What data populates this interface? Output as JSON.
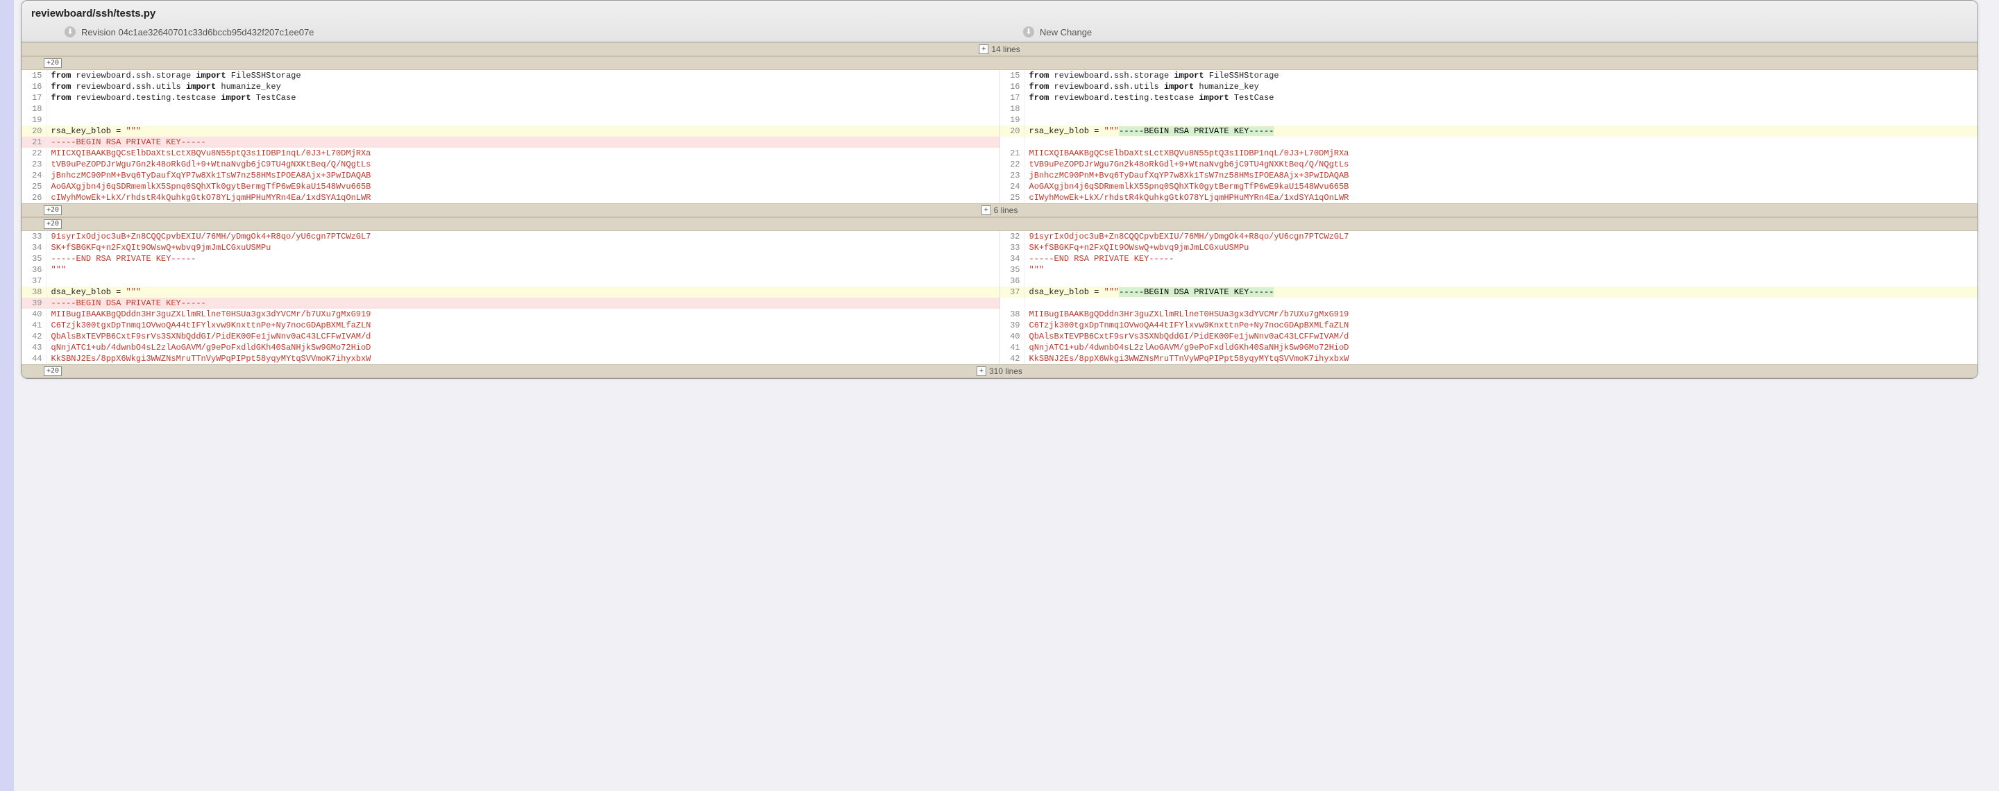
{
  "file": {
    "title": "reviewboard/ssh/tests.py",
    "left_revision_label": "Revision 04c1ae32640701c33d6bccb95d432f207c1ee07e",
    "right_revision_label": "New Change"
  },
  "expands": {
    "top_count": "14 lines",
    "mid_count": "6 lines",
    "bottom_count": "310 lines",
    "chunk_label": "20"
  },
  "blocks": [
    {
      "expand_above": {
        "ln": "20"
      },
      "rows": [
        {
          "type": "normal",
          "lng": "15",
          "rng": "15",
          "ltokens": [
            [
              "kw",
              "from"
            ],
            [
              "plain",
              " reviewboard.ssh.storage "
            ],
            [
              "kw",
              "import"
            ],
            [
              "plain",
              " FileSSHStorage"
            ]
          ],
          "rtokens": [
            [
              "kw",
              "from"
            ],
            [
              "plain",
              " reviewboard.ssh.storage "
            ],
            [
              "kw",
              "import"
            ],
            [
              "plain",
              " FileSSHStorage"
            ]
          ]
        },
        {
          "type": "normal",
          "lng": "16",
          "rng": "16",
          "ltokens": [
            [
              "kw",
              "from"
            ],
            [
              "plain",
              " reviewboard.ssh.utils "
            ],
            [
              "kw",
              "import"
            ],
            [
              "plain",
              " humanize_key"
            ]
          ],
          "rtokens": [
            [
              "kw",
              "from"
            ],
            [
              "plain",
              " reviewboard.ssh.utils "
            ],
            [
              "kw",
              "import"
            ],
            [
              "plain",
              " humanize_key"
            ]
          ]
        },
        {
          "type": "normal",
          "lng": "17",
          "rng": "17",
          "ltokens": [
            [
              "kw",
              "from"
            ],
            [
              "plain",
              " reviewboard.testing.testcase "
            ],
            [
              "kw",
              "import"
            ],
            [
              "plain",
              " TestCase"
            ]
          ],
          "rtokens": [
            [
              "kw",
              "from"
            ],
            [
              "plain",
              " reviewboard.testing.testcase "
            ],
            [
              "kw",
              "import"
            ],
            [
              "plain",
              " TestCase"
            ]
          ]
        },
        {
          "type": "normal",
          "lng": "18",
          "rng": "18",
          "ltokens": [],
          "rtokens": []
        },
        {
          "type": "normal",
          "lng": "19",
          "rng": "19",
          "ltokens": [],
          "rtokens": []
        },
        {
          "type": "changed",
          "lng": "20",
          "rng": "20",
          "ltokens": [
            [
              "plain",
              "rsa_key_blob = "
            ],
            [
              "str",
              "\"\"\""
            ]
          ],
          "rtokens": [
            [
              "plain",
              "rsa_key_blob = "
            ],
            [
              "str",
              "\"\"\""
            ],
            [
              "hl",
              "-----BEGIN RSA PRIVATE KEY-----"
            ]
          ]
        },
        {
          "type": "deleted",
          "lng": "21",
          "rng": "",
          "ltokens": [
            [
              "str",
              "-----BEGIN RSA PRIVATE KEY-----"
            ]
          ],
          "rtokens": []
        },
        {
          "type": "normal",
          "lng": "22",
          "rng": "21",
          "ltokens": [
            [
              "str",
              "MIICXQIBAAKBgQCsElbDaXtsLctXBQVu8N55ptQ3s1IDBP1nqL/0J3+L70DMjRXa"
            ]
          ],
          "rtokens": [
            [
              "str",
              "MIICXQIBAAKBgQCsElbDaXtsLctXBQVu8N55ptQ3s1IDBP1nqL/0J3+L70DMjRXa"
            ]
          ]
        },
        {
          "type": "normal",
          "lng": "23",
          "rng": "22",
          "ltokens": [
            [
              "str",
              "tVB9uPeZOPDJrWgu7Gn2k48oRkGdl+9+WtnaNvgb6jC9TU4gNXKtBeq/Q/NQgtLs"
            ]
          ],
          "rtokens": [
            [
              "str",
              "tVB9uPeZOPDJrWgu7Gn2k48oRkGdl+9+WtnaNvgb6jC9TU4gNXKtBeq/Q/NQgtLs"
            ]
          ]
        },
        {
          "type": "normal",
          "lng": "24",
          "rng": "23",
          "ltokens": [
            [
              "str",
              "jBnhczMC90PnM+Bvq6TyDaufXqYP7w8Xk1TsW7nz58HMsIPOEA8Ajx+3PwIDAQAB"
            ]
          ],
          "rtokens": [
            [
              "str",
              "jBnhczMC90PnM+Bvq6TyDaufXqYP7w8Xk1TsW7nz58HMsIPOEA8Ajx+3PwIDAQAB"
            ]
          ]
        },
        {
          "type": "normal",
          "lng": "25",
          "rng": "24",
          "ltokens": [
            [
              "str",
              "AoGAXgjbn4j6qSDRmemlkX5Spnq0SQhXTk0gytBermgTfP6wE9kaU1548Wvu665B"
            ]
          ],
          "rtokens": [
            [
              "str",
              "AoGAXgjbn4j6qSDRmemlkX5Spnq0SQhXTk0gytBermgTfP6wE9kaU1548Wvu665B"
            ]
          ]
        },
        {
          "type": "normal",
          "lng": "26",
          "rng": "25",
          "ltokens": [
            [
              "str",
              "cIWyhMowEk+LkX/rhdstR4kQuhkgGtkO78YLjqmHPHuMYRn4Ea/1xdSYA1qOnLWR"
            ]
          ],
          "rtokens": [
            [
              "str",
              "cIWyhMowEk+LkX/rhdstR4kQuhkgGtkO78YLjqmHPHuMYRn4Ea/1xdSYA1qOnLWR"
            ]
          ]
        }
      ]
    },
    {
      "expand_above": {
        "ln": "20"
      },
      "rows": [
        {
          "type": "normal",
          "lng": "33",
          "rng": "32",
          "ltokens": [
            [
              "str",
              "91syrIxOdjoc3uB+Zn8CQQCpvbEXIU/76MH/yDmgOk4+R8qo/yU6cgn7PTCWzGL7"
            ]
          ],
          "rtokens": [
            [
              "str",
              "91syrIxOdjoc3uB+Zn8CQQCpvbEXIU/76MH/yDmgOk4+R8qo/yU6cgn7PTCWzGL7"
            ]
          ]
        },
        {
          "type": "normal",
          "lng": "34",
          "rng": "33",
          "ltokens": [
            [
              "str",
              "SK+fSBGKFq+n2FxQIt9OWswQ+wbvq9jmJmLCGxuUSMPu"
            ]
          ],
          "rtokens": [
            [
              "str",
              "SK+fSBGKFq+n2FxQIt9OWswQ+wbvq9jmJmLCGxuUSMPu"
            ]
          ]
        },
        {
          "type": "normal",
          "lng": "35",
          "rng": "34",
          "ltokens": [
            [
              "str",
              "-----END RSA PRIVATE KEY-----"
            ]
          ],
          "rtokens": [
            [
              "str",
              "-----END RSA PRIVATE KEY-----"
            ]
          ]
        },
        {
          "type": "normal",
          "lng": "36",
          "rng": "35",
          "ltokens": [
            [
              "str",
              "\"\"\""
            ]
          ],
          "rtokens": [
            [
              "str",
              "\"\"\""
            ]
          ]
        },
        {
          "type": "normal",
          "lng": "37",
          "rng": "36",
          "ltokens": [],
          "rtokens": []
        },
        {
          "type": "changed",
          "lng": "38",
          "rng": "37",
          "ltokens": [
            [
              "plain",
              "dsa_key_blob = "
            ],
            [
              "str",
              "\"\"\""
            ]
          ],
          "rtokens": [
            [
              "plain",
              "dsa_key_blob = "
            ],
            [
              "str",
              "\"\"\""
            ],
            [
              "hl",
              "-----BEGIN DSA PRIVATE KEY-----"
            ]
          ]
        },
        {
          "type": "deleted",
          "lng": "39",
          "rng": "",
          "ltokens": [
            [
              "str",
              "-----BEGIN DSA PRIVATE KEY-----"
            ]
          ],
          "rtokens": []
        },
        {
          "type": "normal",
          "lng": "40",
          "rng": "38",
          "ltokens": [
            [
              "str",
              "MIIBugIBAAKBgQDddn3Hr3guZXLlmRLlneT0HSUa3gx3dYVCMr/b7UXu7gMxG919"
            ]
          ],
          "rtokens": [
            [
              "str",
              "MIIBugIBAAKBgQDddn3Hr3guZXLlmRLlneT0HSUa3gx3dYVCMr/b7UXu7gMxG919"
            ]
          ]
        },
        {
          "type": "normal",
          "lng": "41",
          "rng": "39",
          "ltokens": [
            [
              "str",
              "C6Tzjk300tgxDpTnmq1OVwoQA44tIFYlxvw9KnxttnPe+Ny7nocGDApBXMLfaZLN"
            ]
          ],
          "rtokens": [
            [
              "str",
              "C6Tzjk300tgxDpTnmq1OVwoQA44tIFYlxvw9KnxttnPe+Ny7nocGDApBXMLfaZLN"
            ]
          ]
        },
        {
          "type": "normal",
          "lng": "42",
          "rng": "40",
          "ltokens": [
            [
              "str",
              "QbAlsBxTEVPB6CxtF9srVs3SXNbQddGI/PidEK00Fe1jwNnv0aC43LCFFwIVAM/d"
            ]
          ],
          "rtokens": [
            [
              "str",
              "QbAlsBxTEVPB6CxtF9srVs3SXNbQddGI/PidEK00Fe1jwNnv0aC43LCFFwIVAM/d"
            ]
          ]
        },
        {
          "type": "normal",
          "lng": "43",
          "rng": "41",
          "ltokens": [
            [
              "str",
              "qNnjATC1+ub/4dwnbO4sL2zlAoGAVM/g9ePoFxdldGKh40SaNHjkSw9GMo72HioD"
            ]
          ],
          "rtokens": [
            [
              "str",
              "qNnjATC1+ub/4dwnbO4sL2zlAoGAVM/g9ePoFxdldGKh40SaNHjkSw9GMo72HioD"
            ]
          ]
        },
        {
          "type": "normal",
          "lng": "44",
          "rng": "42",
          "ltokens": [
            [
              "str",
              "KkSBNJ2Es/8ppX6Wkgi3WWZNsMruTTnVyWPqPIPpt58yqyMYtqSVVmoK7ihyxbxW"
            ]
          ],
          "rtokens": [
            [
              "str",
              "KkSBNJ2Es/8ppX6Wkgi3WWZNsMruTTnVyWPqPIPpt58yqyMYtqSVVmoK7ihyxbxW"
            ]
          ]
        }
      ]
    }
  ]
}
